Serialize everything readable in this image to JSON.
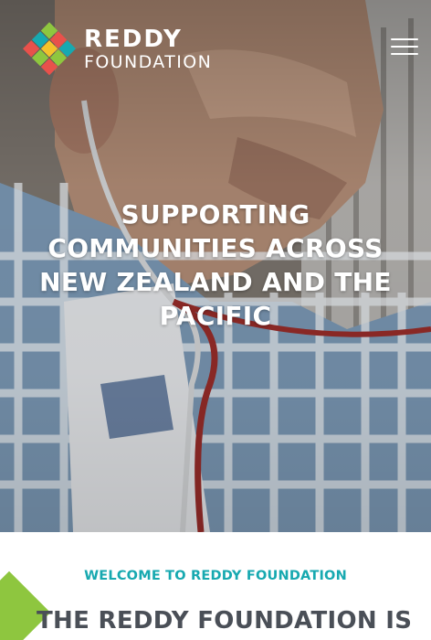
{
  "brand": {
    "name_line1": "REDDY",
    "name_line2": "FOUNDATION",
    "logo_icon": "diamond-grid-logo-icon",
    "logo_colors": [
      "#8ec63f",
      "#e8514b",
      "#17a9b0",
      "#f3c32b"
    ]
  },
  "header": {
    "menu_icon": "hamburger-menu-icon"
  },
  "hero": {
    "title": "SUPPORTING COMMUNITIES ACROSS NEW ZEALAND AND THE PACIFIC"
  },
  "welcome": {
    "eyebrow": "WELCOME TO REDDY FOUNDATION",
    "heading": "THE REDDY FOUNDATION IS"
  },
  "colors": {
    "accent_teal": "#17a9b0",
    "accent_green": "#8ec63f",
    "heading_gray": "#4a4f57",
    "white": "#ffffff"
  }
}
